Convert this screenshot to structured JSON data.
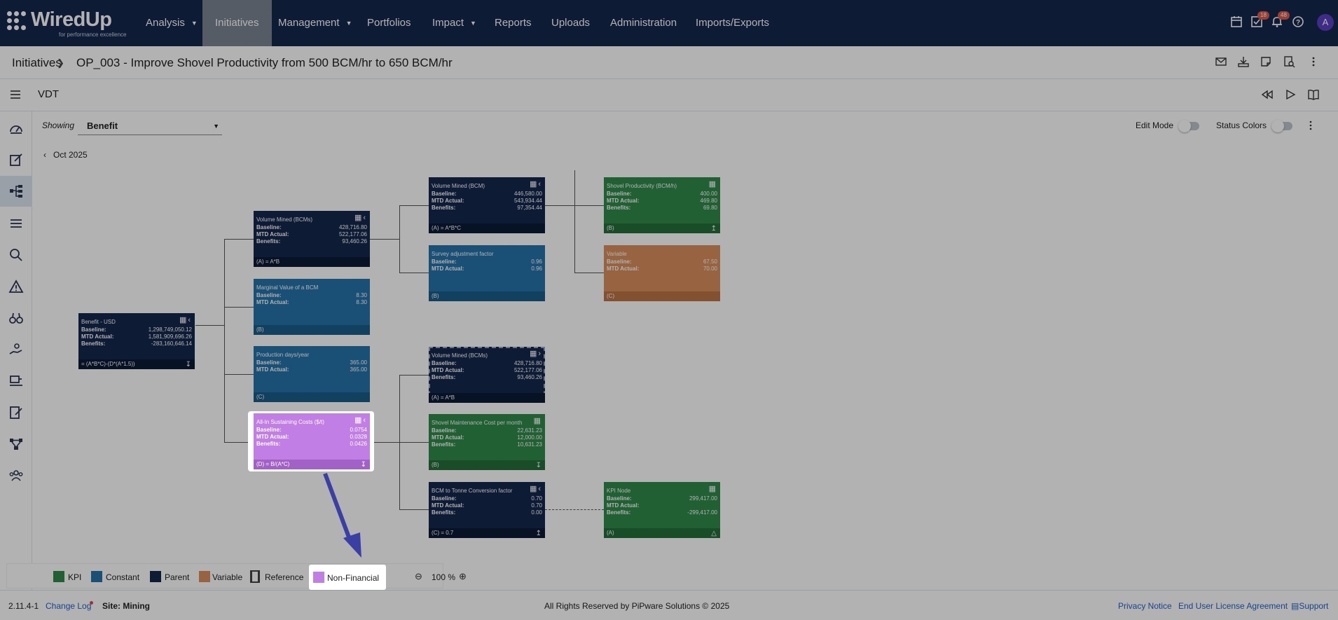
{
  "nav": {
    "logo_text": "WiredUp",
    "logo_tagline": "for performance excellence",
    "items": [
      {
        "label": "Analysis",
        "dropdown": true
      },
      {
        "label": "Initiatives",
        "active": true
      },
      {
        "label": "Management",
        "dropdown": true
      },
      {
        "label": "Portfolios"
      },
      {
        "label": "Impact",
        "dropdown": true
      },
      {
        "label": "Reports"
      },
      {
        "label": "Uploads"
      },
      {
        "label": "Administration"
      },
      {
        "label": "Imports/Exports"
      }
    ],
    "icons": [
      "calendar-icon",
      "tasks-icon",
      "bell-icon",
      "help-icon"
    ],
    "tasks_badge": "18",
    "notifications_badge": "48",
    "avatar_initial": "A"
  },
  "breadcrumb": {
    "root": "Initiatives",
    "current": "OP_003 - Improve Shovel Productivity from 500 BCM/hr to 650 BCM/hr"
  },
  "vdt": {
    "title": "VDT",
    "showing_label": "Showing",
    "showing_value": "Benefit",
    "month": "Oct 2025",
    "edit_mode_label": "Edit Mode",
    "status_colors_label": "Status Colors"
  },
  "nodes": {
    "root": {
      "title": "Benefit - USD",
      "baseline": "1,298,749,050.12",
      "mtd": "1,581,909,696.26",
      "benefits": "-283,160,646.14",
      "footer": "= (A*B*C)-(D*(A*1.5))"
    },
    "n1": {
      "title": "Volume Mined (BCMs)",
      "baseline": "428,716.80",
      "mtd": "522,177.06",
      "benefits": "93,460.26",
      "footer": "(A) = A*B"
    },
    "n2": {
      "title": "Marginal Value of a BCM",
      "baseline": "8.30",
      "mtd": "8.30",
      "footer": "(B)"
    },
    "n3": {
      "title": "Production days/year",
      "baseline": "365.00",
      "mtd": "365.00",
      "footer": "(C)"
    },
    "n4": {
      "title": "All-In Sustaining Costs ($/t)",
      "baseline": "0.0754",
      "mtd": "0.0328",
      "benefits": "0.0426",
      "footer": "(D) = B/(A*C)"
    },
    "n5": {
      "title": "Volume Mined (BCM)",
      "baseline": "446,580.00",
      "mtd": "543,934.44",
      "benefits": "97,354.44",
      "footer": "(A) = A*B*C"
    },
    "n6": {
      "title": "Survey adjustment factor",
      "baseline": "0.96",
      "mtd": "0.96",
      "footer": "(B)"
    },
    "n7": {
      "title": "Volume Mined (BCMs)",
      "baseline": "428,716.80",
      "mtd": "522,177.06",
      "benefits": "93,460.26",
      "footer": "(A) = A*B"
    },
    "n8": {
      "title": "Shovel Maintenance Cost per month",
      "baseline": "22,631.23",
      "mtd": "12,000.00",
      "benefits": "10,631.23",
      "footer": "(B)"
    },
    "n9": {
      "title": "BCM to Tonne Conversion factor",
      "baseline": "0.70",
      "mtd": "0.70",
      "benefits": "0.00",
      "footer": "(C) = 0.7"
    },
    "n10": {
      "title": "Shovel Productivity (BCM/h)",
      "baseline": "400.00",
      "mtd": "469.80",
      "benefits": "69.80",
      "footer": "(B)"
    },
    "n11": {
      "title": "Variable",
      "baseline": "67.50",
      "mtd": "70.00",
      "footer": "(C)"
    },
    "n12": {
      "title": "KPI Node",
      "baseline": "299,417.00",
      "mtd": "",
      "benefits": "-299,417.00",
      "footer": "(A)"
    }
  },
  "labels": {
    "baseline": "Baseline:",
    "mtd": "MTD Actual:",
    "benefits": "Benefits:"
  },
  "legend": {
    "kpi": "KPI",
    "constant": "Constant",
    "parent": "Parent",
    "variable": "Variable",
    "reference": "Reference",
    "non_financial": "Non-Financial",
    "zoom": "100 %"
  },
  "colors": {
    "nav": "#13274d",
    "parent": "#13274d",
    "constant": "#2673a8",
    "kpi": "#2f8a4a",
    "variable": "#d98e5c",
    "non_financial": "#c17ee4",
    "annotation_arrow": "#3a3fa3"
  },
  "footer": {
    "version": "2.11.4-1",
    "change_log": "Change Log",
    "site": "Site: Mining",
    "copyright": "All Rights Reserved by PiPware Solutions © 2025",
    "privacy": "Privacy Notice",
    "eula": "End User License Agreement",
    "support": "Support"
  }
}
